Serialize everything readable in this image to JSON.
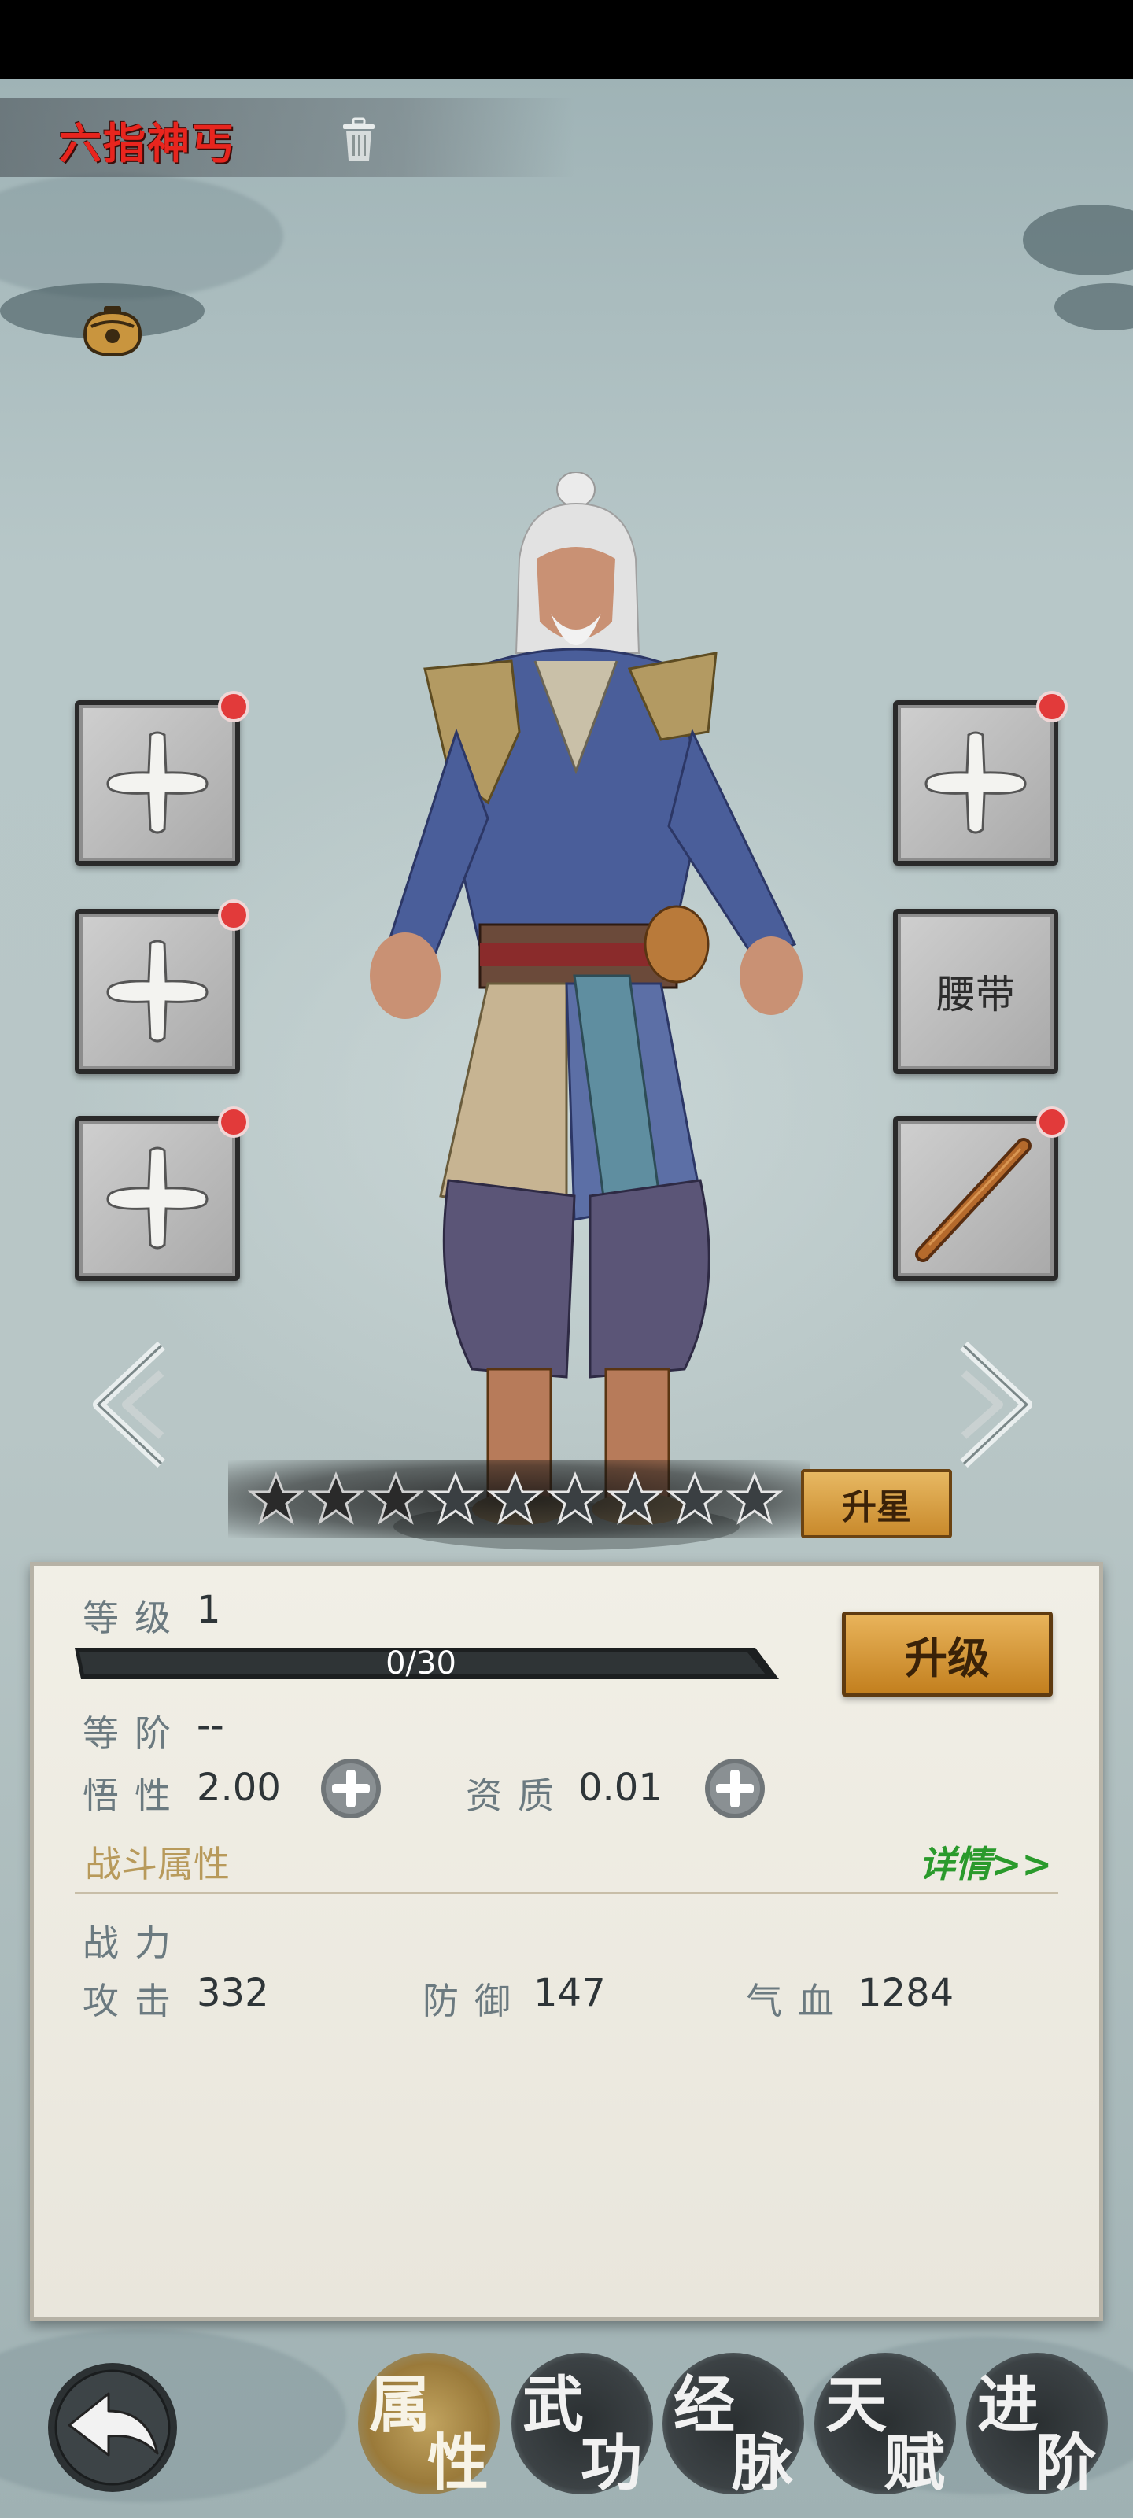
{
  "hero": {
    "name": "六指神丐"
  },
  "equipment": {
    "left_slots": [
      "empty",
      "empty",
      "empty"
    ],
    "right_slots": [
      "empty",
      "腰带",
      "stick"
    ],
    "belt_label": "腰带"
  },
  "stars": {
    "total": 9,
    "filled": 3,
    "button_label": "升星"
  },
  "stats": {
    "level_label": "等级",
    "level_value": "1",
    "exp_text": "0/30",
    "exp_progress": 0,
    "upgrade_label": "升级",
    "rank_label": "等阶",
    "rank_value": "--",
    "comprehension_label": "悟性",
    "comprehension_value": "2.00",
    "aptitude_label": "资质",
    "aptitude_value": "0.01",
    "battle_attr_title": "战斗属性",
    "details_link": "详情>>",
    "power_label": "战力",
    "attack_label": "攻击",
    "attack_value": "332",
    "defense_label": "防御",
    "defense_value": "147",
    "hp_label": "气血",
    "hp_value": "1284"
  },
  "nav": {
    "tabs": [
      {
        "c1": "属",
        "c2": "性",
        "active": true
      },
      {
        "c1": "武",
        "c2": "功",
        "active": false
      },
      {
        "c1": "经",
        "c2": "脉",
        "active": false
      },
      {
        "c1": "天",
        "c2": "赋",
        "active": false
      },
      {
        "c1": "进",
        "c2": "阶",
        "active": false
      }
    ]
  },
  "colors": {
    "name_red": "#e8251e",
    "gold_button": "#d9a040",
    "details_green": "#2a9a2c",
    "badge_red": "#e23a3a"
  }
}
